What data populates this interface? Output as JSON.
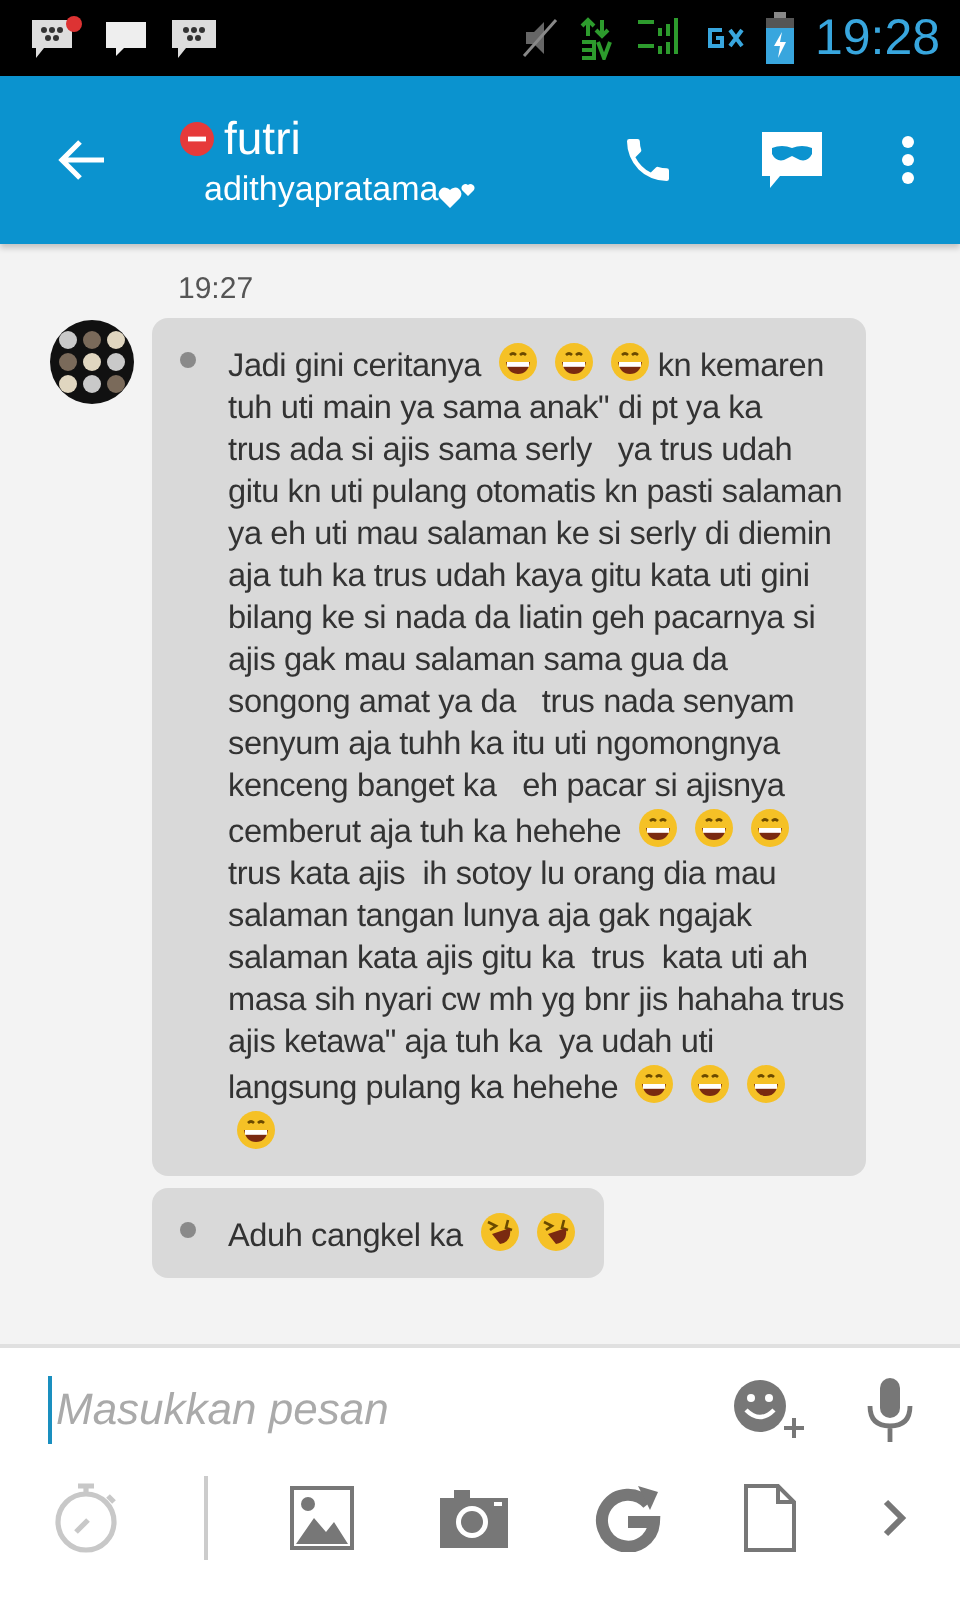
{
  "status_bar": {
    "time": "19:28"
  },
  "header": {
    "contact": "futri",
    "status": "adithyapratama"
  },
  "chat": {
    "timestamp": "19:27",
    "messages": [
      {
        "parts": [
          {
            "kind": "text",
            "text": "Jadi gini ceritanya"
          },
          {
            "kind": "grin"
          },
          {
            "kind": "grin"
          },
          {
            "kind": "grin"
          },
          {
            "kind": "text",
            "text": "kn kemaren tuh uti main ya sama anak\" di pt ya ka    trus ada si ajis sama serly   ya trus udah gitu kn uti pulang otomatis kn pasti salaman ya eh uti mau salaman ke si serly di diemin aja tuh ka trus udah kaya gitu kata uti gini bilang ke si nada da liatin geh pacarnya si ajis gak mau salaman sama gua da songong amat ya da   trus nada senyam senyum aja tuhh ka itu uti ngomongnya kenceng banget ka   eh pacar si ajisnya cemberut aja tuh ka hehehe"
          },
          {
            "kind": "grin"
          },
          {
            "kind": "grin"
          },
          {
            "kind": "grin"
          },
          {
            "kind": "text",
            "text": "trus kata ajis  ih sotoy lu orang dia mau salaman tangan lunya aja gak ngajak salaman kata ajis gitu ka  trus  kata uti ah masa sih nyari cw mh yg bnr jis hahaha trus ajis ketawa\" aja tuh ka  ya udah uti langsung pulang ka hehehe"
          },
          {
            "kind": "grin"
          },
          {
            "kind": "grin"
          },
          {
            "kind": "grin"
          },
          {
            "kind": "grin"
          }
        ]
      },
      {
        "parts": [
          {
            "kind": "text",
            "text": "Aduh cangkel ka"
          },
          {
            "kind": "laugh"
          },
          {
            "kind": "laugh"
          }
        ]
      }
    ]
  },
  "composer": {
    "placeholder": "Masukkan pesan"
  }
}
